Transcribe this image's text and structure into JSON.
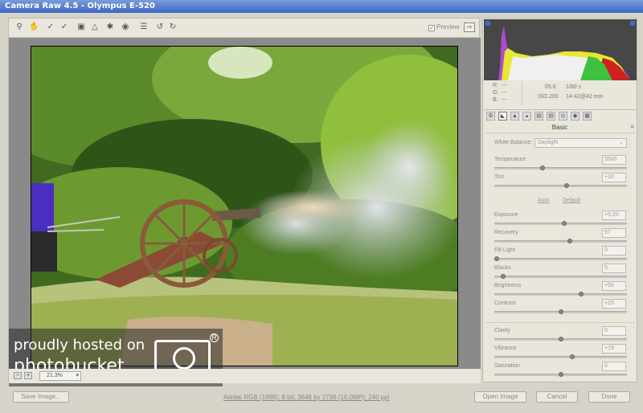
{
  "window": {
    "title": "Camera Raw 4.5  -  Olympus E-520"
  },
  "toolbar": {
    "preview_label": "Preview",
    "preview_checked": true
  },
  "zoom": {
    "value": "21.3%"
  },
  "watermark": {
    "line1": "proudly hosted on",
    "line2": "photobucket"
  },
  "readout": {
    "r": "R:",
    "g": "G:",
    "b": "B:",
    "dash": "---",
    "aperture": "f/5.6",
    "shutter": "1/80 s",
    "iso": "ISO 200",
    "lens": "14-42@42 mm"
  },
  "panel": {
    "title": "Basic",
    "white_balance_label": "White Balance:",
    "white_balance_value": "Daylight",
    "auto_label": "Auto",
    "default_label": "Default",
    "sliders": [
      {
        "label": "Temperature",
        "value": "5500",
        "pos": 0.36
      },
      {
        "label": "Tint",
        "value": "+10",
        "pos": 0.55
      },
      {
        "label": "Exposure",
        "value": "+0.25",
        "pos": 0.53
      },
      {
        "label": "Recovery",
        "value": "57",
        "pos": 0.57
      },
      {
        "label": "Fill Light",
        "value": "0",
        "pos": 0.0
      },
      {
        "label": "Blacks",
        "value": "5",
        "pos": 0.05
      },
      {
        "label": "Brightness",
        "value": "+50",
        "pos": 0.66
      },
      {
        "label": "Contrast",
        "value": "+25",
        "pos": 0.5
      },
      {
        "label": "Clarity",
        "value": "0",
        "pos": 0.5
      },
      {
        "label": "Vibrance",
        "value": "+19",
        "pos": 0.59
      },
      {
        "label": "Saturation",
        "value": "0",
        "pos": 0.5
      }
    ]
  },
  "bottom": {
    "save_label": "Save Image...",
    "info": "Adobe RGB (1998); 8 bit; 3648 by 2736 (10.0MP); 240 ppi",
    "open_label": "Open Image",
    "cancel_label": "Cancel",
    "done_label": "Done"
  }
}
